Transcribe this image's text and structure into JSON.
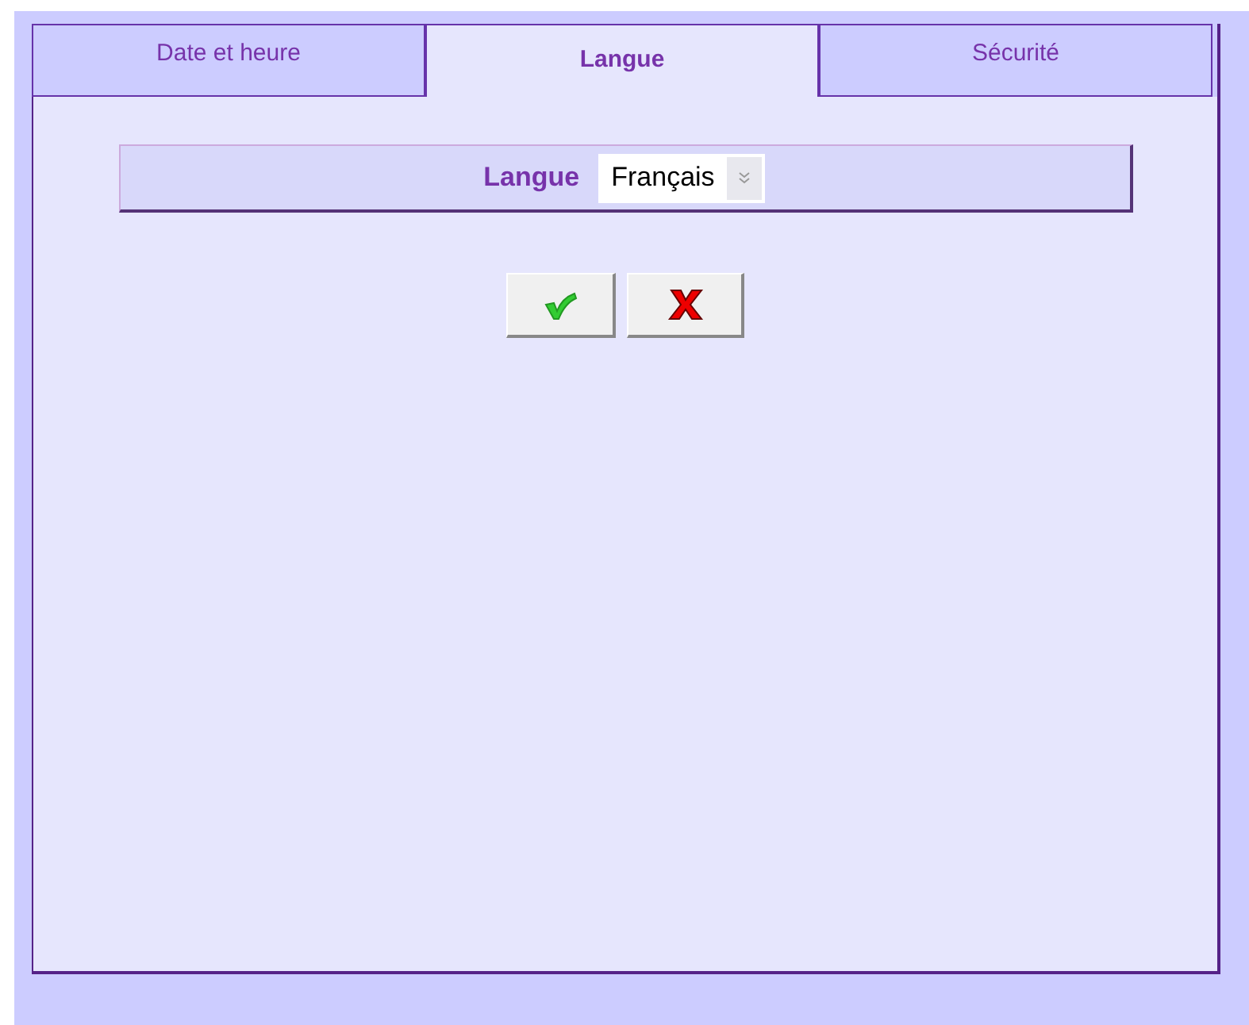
{
  "tabs": [
    {
      "label": "Date et heure",
      "selected": false
    },
    {
      "label": "Langue",
      "selected": true
    },
    {
      "label": "Sécurité",
      "selected": false
    }
  ],
  "language": {
    "label": "Langue",
    "value": "Français"
  },
  "buttons": [
    {
      "kind": "confirm"
    },
    {
      "kind": "cancel"
    }
  ]
}
